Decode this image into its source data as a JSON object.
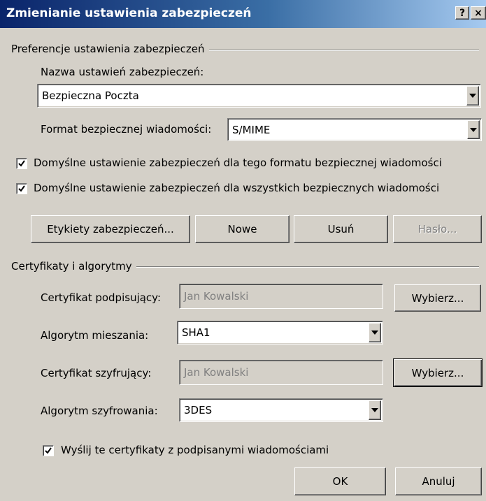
{
  "window": {
    "title": "Zmienianie ustawienia zabezpieczeń",
    "help_label": "?",
    "close_label": "×"
  },
  "preferences": {
    "group_label": "Preferencje ustawienia zabezpieczeń",
    "name_label": "Nazwa ustawień zabezpieczeń:",
    "name_value": "Bezpieczna Poczta",
    "format_label": "Format bezpiecznej wiadomości:",
    "format_value": "S/MIME",
    "default_for_format": {
      "label": "Domyślne ustawienie zabezpieczeń dla tego formatu bezpiecznej wiadomości",
      "checked": true
    },
    "default_for_all": {
      "label": "Domyślne ustawienie zabezpieczeń dla wszystkich bezpiecznych wiadomości",
      "checked": true
    },
    "buttons": {
      "labels": "Etykiety zabezpieczeń...",
      "new": "Nowe",
      "delete": "Usuń",
      "password": "Hasło..."
    }
  },
  "certificates": {
    "group_label": "Certyfikaty i algorytmy",
    "signing_label": "Certyfikat podpisujący:",
    "signing_value": "Jan Kowalski",
    "signing_choose": "Wybierz...",
    "hash_label": "Algorytm mieszania:",
    "hash_value": "SHA1",
    "encryption_label": "Certyfikat szyfrujący:",
    "encryption_value": "Jan Kowalski",
    "encryption_choose": "Wybierz...",
    "enc_algo_label": "Algorytm szyfrowania:",
    "enc_algo_value": "3DES",
    "send_certs": {
      "label": "Wyślij te certyfikaty z podpisanymi wiadomościami",
      "checked": true
    }
  },
  "footer": {
    "ok": "OK",
    "cancel": "Anuluj"
  }
}
